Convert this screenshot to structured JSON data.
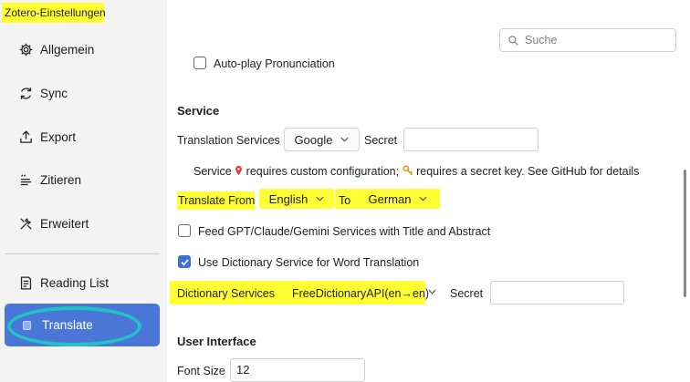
{
  "window": {
    "title": "Zotero-Einstellungen"
  },
  "sidebar": {
    "items": [
      {
        "label": "Allgemein",
        "icon": "gear-icon"
      },
      {
        "label": "Sync",
        "icon": "sync-icon"
      },
      {
        "label": "Export",
        "icon": "export-icon"
      },
      {
        "label": "Zitieren",
        "icon": "quote-icon"
      },
      {
        "label": "Erweitert",
        "icon": "tools-icon"
      },
      {
        "label": "Reading List",
        "icon": "reading-list-icon"
      },
      {
        "label": "Translate",
        "icon": "translate-icon",
        "active": true
      }
    ]
  },
  "search": {
    "placeholder": "Suche"
  },
  "options": {
    "auto_play": {
      "label": "Auto-play Pronunciation",
      "checked": false
    }
  },
  "service": {
    "title": "Service",
    "translation_services_label": "Translation Services",
    "translation_service_value": "Google",
    "secret_label": "Secret",
    "secret_value": "",
    "info_part1": "Service",
    "info_pin_icon": "pin-icon",
    "info_part2": "requires custom configuration;",
    "info_key_icon": "key-icon",
    "info_part3": "requires a secret key. See GitHub for details",
    "translate_from_label": "Translate From",
    "from_language": "English",
    "to_label": "To",
    "to_language": "German",
    "feed_gpt": {
      "label": "Feed GPT/Claude/Gemini Services with Title and Abstract",
      "checked": false
    },
    "use_dictionary": {
      "label": "Use Dictionary Service for Word Translation",
      "checked": true
    },
    "dictionary_services_label": "Dictionary Services",
    "dictionary_service_value": "FreeDictionaryAPI(en→en)",
    "dictionary_secret_label": "Secret",
    "dictionary_secret_value": ""
  },
  "user_interface": {
    "title": "User Interface",
    "font_size_label": "Font Size",
    "font_size_value": "12"
  },
  "colors": {
    "highlight": "#ffff33",
    "active_nav": "#4a76d8",
    "annotation_ring": "#21c2c2",
    "checkbox_checked": "#3d6fd6"
  }
}
